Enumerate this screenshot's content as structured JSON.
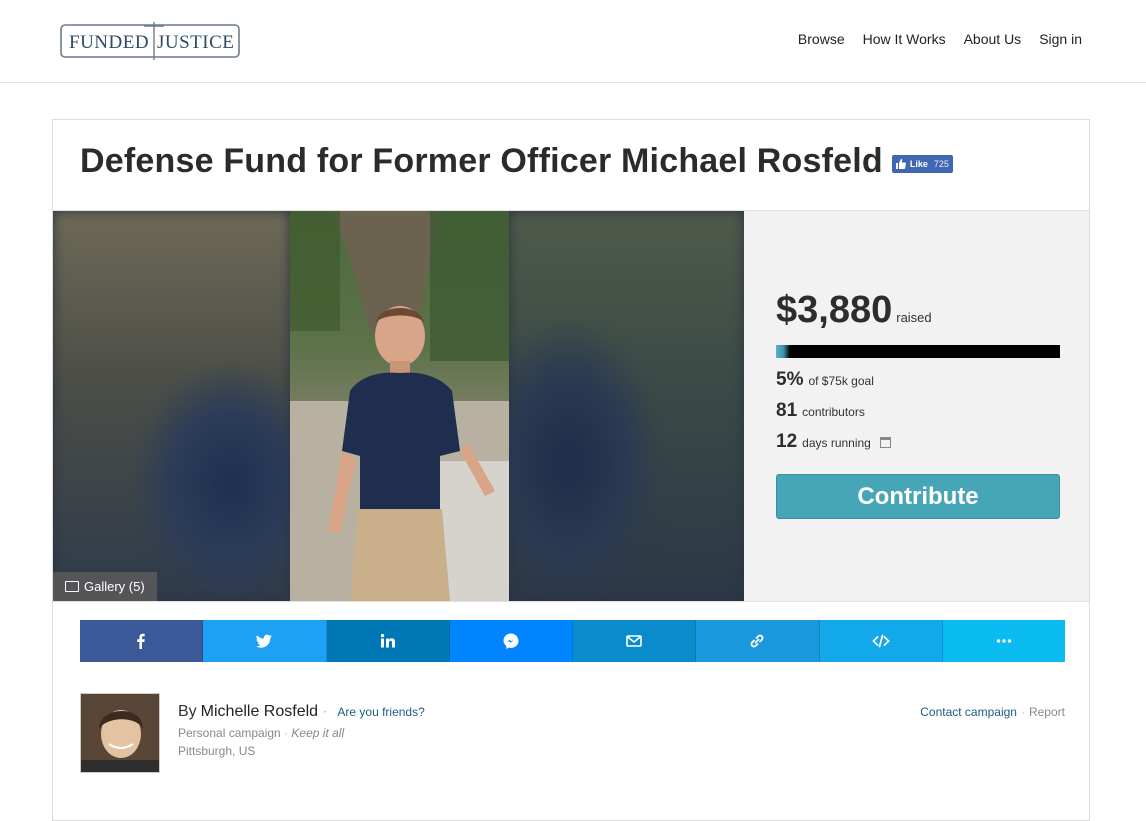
{
  "header": {
    "logo_left": "FUNDED",
    "logo_right": "JUSTICE",
    "nav": [
      "Browse",
      "How It Works",
      "About Us",
      "Sign in"
    ]
  },
  "campaign": {
    "title": "Defense Fund for Former Officer Michael Rosfeld",
    "fb_like_label": "Like",
    "fb_like_count": "725",
    "gallery_label": "Gallery (5)"
  },
  "stats": {
    "amount": "$3,880",
    "raised_label": "raised",
    "progress_fraction": 0.05,
    "percent": "5%",
    "goal_label": "of $75k goal",
    "contributors": "81",
    "contributors_label": "contributors",
    "days": "12",
    "days_label": "days running",
    "contribute_label": "Contribute"
  },
  "share": [
    {
      "name": "facebook",
      "color": "#3b5998",
      "icon": "facebook-icon"
    },
    {
      "name": "twitter",
      "color": "#1da1f2",
      "icon": "twitter-icon"
    },
    {
      "name": "linkedin",
      "color": "#0077b5",
      "icon": "linkedin-icon"
    },
    {
      "name": "messenger",
      "color": "#0084ff",
      "icon": "messenger-icon"
    },
    {
      "name": "email",
      "color": "#0a8bcc",
      "icon": "email-icon"
    },
    {
      "name": "link",
      "color": "#1a98dd",
      "icon": "link-icon"
    },
    {
      "name": "embed",
      "color": "#12a8ea",
      "icon": "code-icon"
    },
    {
      "name": "more",
      "color": "#0bbcf2",
      "icon": "more-icon"
    }
  ],
  "author": {
    "by": "By",
    "name": "Michelle Rosfeld",
    "friends_link": "Are you friends?",
    "campaign_type": "Personal campaign",
    "keep": "Keep it all",
    "location": "Pittsburgh, US",
    "contact": "Contact campaign",
    "report": "Report"
  }
}
